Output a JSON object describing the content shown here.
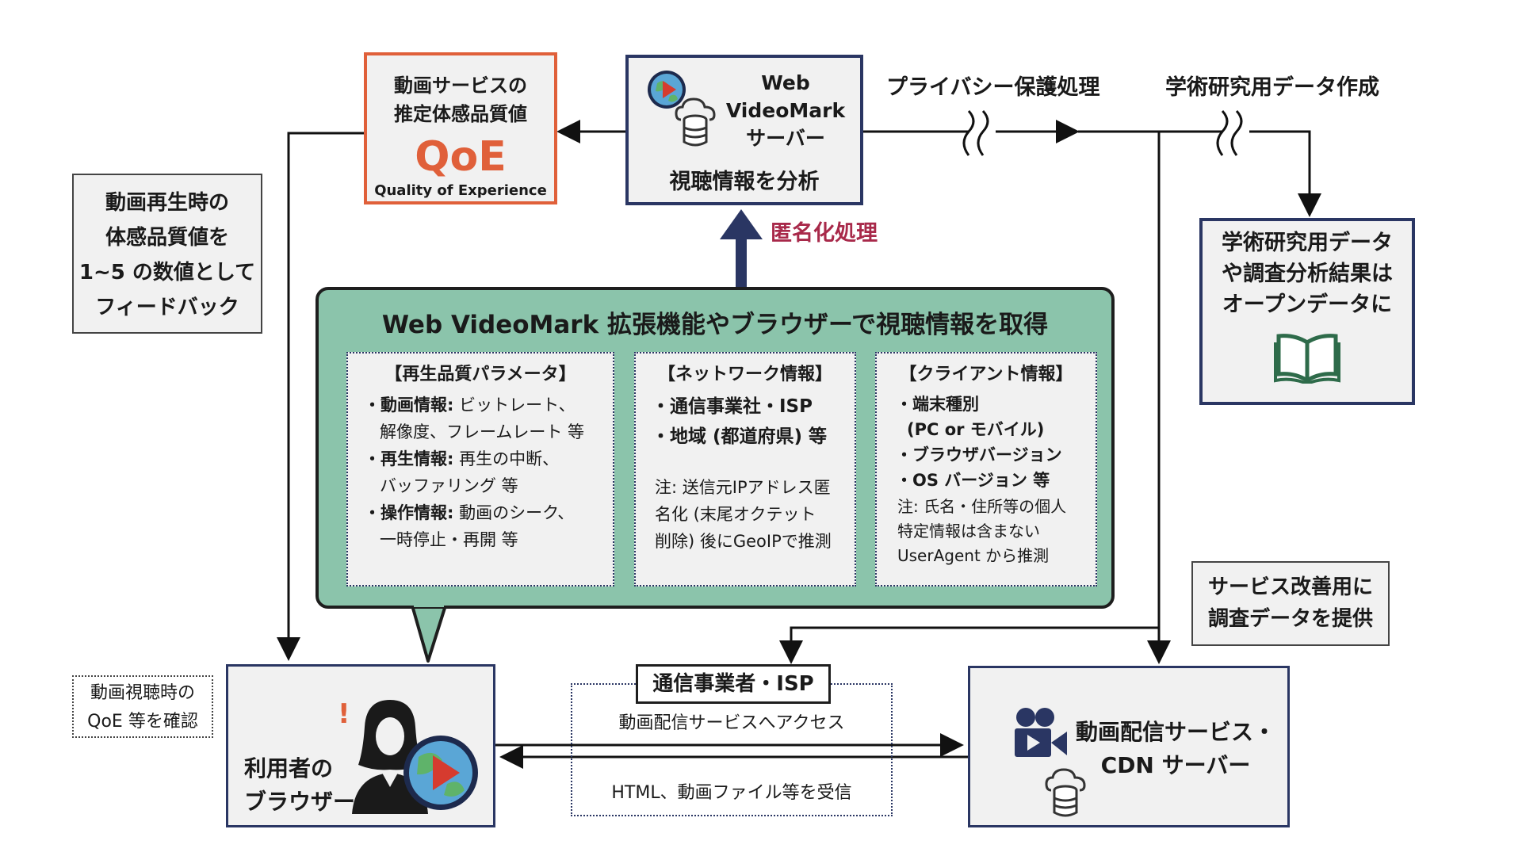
{
  "qoe_box": {
    "line1": "動画サービスの",
    "line2": "推定体感品質値",
    "big": "QoE",
    "sub": "Quality of Experience"
  },
  "server_box": {
    "line1": "Web",
    "line2": "VideoMark",
    "line3": "サーバー",
    "analyze": "視聴情報を分析"
  },
  "privacy_label": "プライバシー保護処理",
  "academic_label": "学術研究用データ作成",
  "anonymize_label": "匿名化処理",
  "feedback_box": {
    "lines": [
      "動画再生時の",
      "体感品質値を",
      "1~5 の数値として",
      "フィードバック"
    ]
  },
  "open_data_box": {
    "lines": [
      "学術研究用データ",
      "や調査分析結果は",
      "オープンデータに"
    ]
  },
  "green_panel": {
    "title": "Web VideoMark 拡張機能やブラウザーで視聴情報を取得",
    "playback": {
      "heading": "【再生品質パラメータ】",
      "item1_key": "・動画情報:",
      "item1_val": " ビットレート、",
      "item1_cont": "解像度、フレームレート 等",
      "item2_key": "・再生情報:",
      "item2_val": " 再生の中断、",
      "item2_cont": "バッファリング 等",
      "item3_key": "・操作情報:",
      "item3_val": " 動画のシーク、",
      "item3_cont": "一時停止・再開 等"
    },
    "network": {
      "heading": "【ネットワーク情報】",
      "item1": "・通信事業社・ISP",
      "item2": "・地域 (都道府県) 等",
      "note1": "注: 送信元IPアドレス匿",
      "note2": "名化 (末尾オクテット",
      "note3": "削除) 後にGeoIPで推測"
    },
    "client": {
      "heading": "【クライアント情報】",
      "item1": "・端末種別",
      "item1_cont": "(PC or モバイル)",
      "item2": "・ブラウザバージョン",
      "item3": "・OS バージョン 等",
      "note1": "注: 氏名・住所等の個人",
      "note2": "特定情報は含まない",
      "note3": "UserAgent から推測"
    }
  },
  "user_box": {
    "line1": "利用者の",
    "line2": "ブラウザー",
    "alert": "!"
  },
  "qoe_check_box": {
    "line1": "動画視聴時の",
    "line2": "QoE 等を確認"
  },
  "isp_section": {
    "label": "通信事業者・ISP",
    "access": "動画配信サービスへアクセス",
    "receive": "HTML、動画ファイル等を受信"
  },
  "cdn_box": {
    "line1": "動画配信サービス・",
    "line2": "CDN サーバー"
  },
  "improve_box": {
    "line1": "サービス改善用に",
    "line2": "調査データを提供"
  },
  "colors": {
    "navy": "#2a3663",
    "orange": "#e0603a",
    "teal": "#8bc4ab",
    "crimson": "#a8294a",
    "box_bg": "#f1f1f1",
    "book_green": "#2e6b4a"
  },
  "icons": [
    "globe-play-icon",
    "cloud-database-icon",
    "person-icon",
    "video-camera-icon",
    "open-book-icon"
  ]
}
